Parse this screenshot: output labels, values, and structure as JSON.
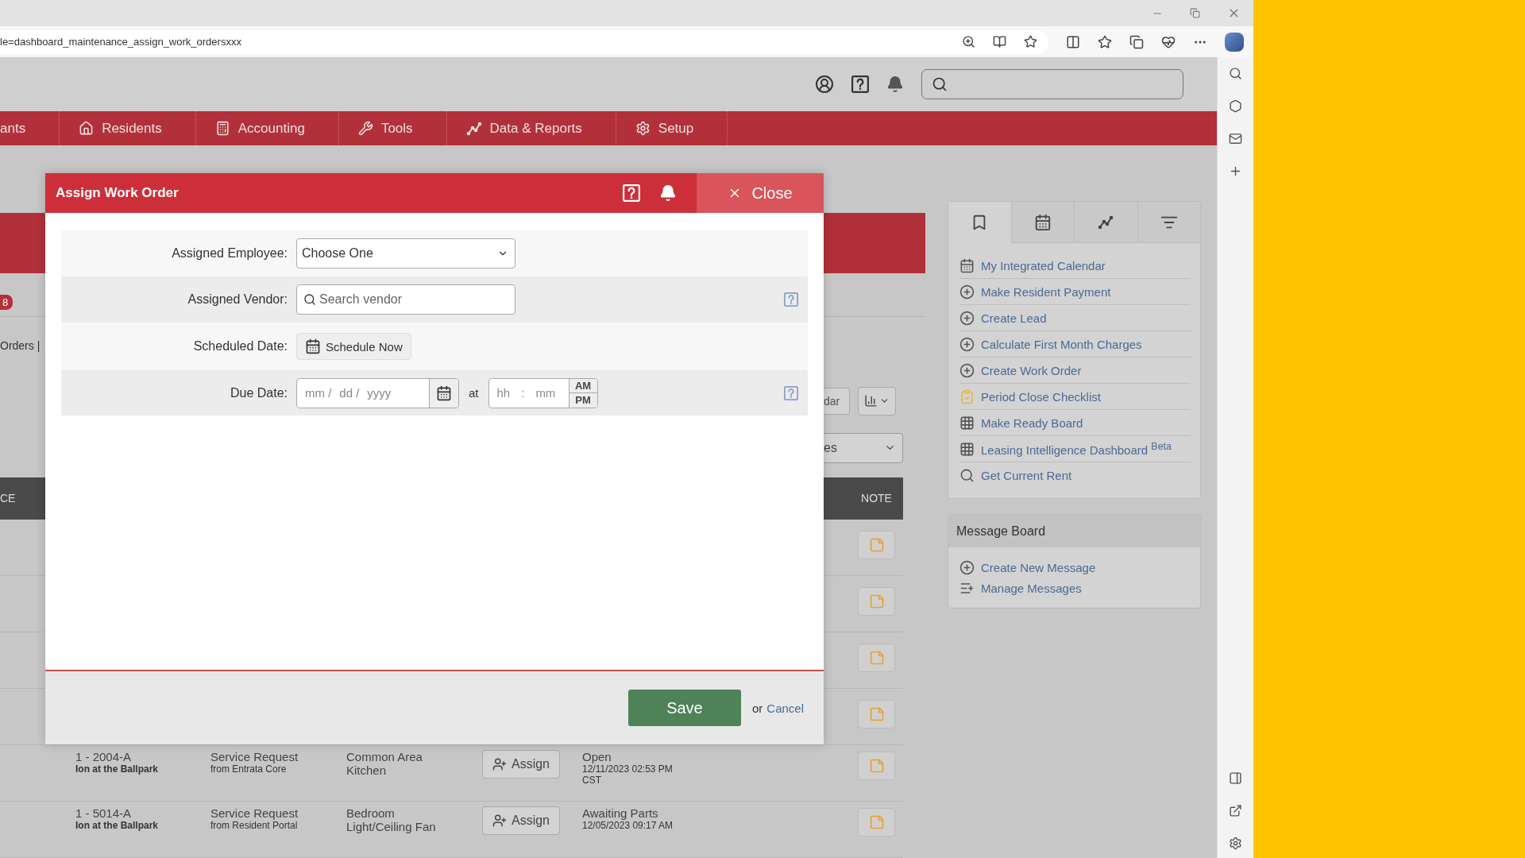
{
  "browser": {
    "url": "le=dashboard_maintenance_assign_work_ordersxxx"
  },
  "nav": [
    {
      "label": "ants",
      "kind": "plain"
    },
    {
      "label": "Residents",
      "kind": "home"
    },
    {
      "label": "Accounting",
      "kind": "calculator"
    },
    {
      "label": "Tools",
      "kind": "tools"
    },
    {
      "label": "Data & Reports",
      "kind": "data"
    },
    {
      "label": "Setup",
      "kind": "gear"
    }
  ],
  "background": {
    "tab_badge": "8",
    "breadcrumb": "Orders |",
    "calendar_button": "dar",
    "filter_select": "es"
  },
  "table": {
    "columns": [
      "CE",
      "NOTE"
    ],
    "rows": [
      {
        "kind": "covered"
      },
      {
        "kind": "covered"
      },
      {
        "kind": "covered"
      },
      {
        "kind": "covered"
      },
      {
        "kind": "full",
        "unit": "1 - 2004-A",
        "property": "Ion at the Ballpark",
        "type": "Service Request",
        "source": "from Entrata Core",
        "location": "Common Area Kitchen",
        "action": "Assign",
        "status": "Open",
        "date": "12/11/2023 02:53 PM",
        "zone": "CST"
      },
      {
        "kind": "full",
        "unit": "1 - 5014-A",
        "property": "Ion at the Ballpark",
        "type": "Service Request",
        "source": "from Resident Portal",
        "location": "Bedroom Light/Ceiling Fan",
        "action": "Assign",
        "status": "Awaiting Parts",
        "date": "12/05/2023 09:17 AM"
      }
    ]
  },
  "modal": {
    "title": "Assign Work Order",
    "close": "Close",
    "fields": [
      {
        "kind": "select",
        "label": "Assigned Employee:",
        "value": "Choose One",
        "help": false
      },
      {
        "kind": "search",
        "label": "Assigned Vendor:",
        "placeholder": "Search vendor",
        "help": true
      },
      {
        "kind": "schedule",
        "label": "Scheduled Date:",
        "button": "Schedule Now",
        "help": false
      },
      {
        "kind": "due",
        "label": "Due Date:",
        "date_parts": [
          "mm /",
          "dd /",
          "yyyy"
        ],
        "at": "at",
        "time_parts": [
          "hh",
          ":",
          "mm"
        ],
        "meridiem": [
          "AM",
          "PM"
        ],
        "help": true
      }
    ],
    "save": "Save",
    "or": "or",
    "cancel": "Cancel"
  },
  "sidebar": {
    "tabs": [
      {
        "kind": "bookmark",
        "selected": true
      },
      {
        "kind": "calendar",
        "selected": false
      },
      {
        "kind": "chart",
        "selected": false
      },
      {
        "kind": "filter",
        "selected": false
      }
    ],
    "links": [
      {
        "kind": "calendar",
        "label": "My Integrated Calendar"
      },
      {
        "kind": "plus",
        "label": "Make Resident Payment"
      },
      {
        "kind": "plus",
        "label": "Create Lead"
      },
      {
        "kind": "plus",
        "label": "Calculate First Month Charges"
      },
      {
        "kind": "plus",
        "label": "Create Work Order"
      },
      {
        "kind": "clipboard",
        "label": "Period Close Checklist"
      },
      {
        "kind": "grid",
        "label": "Make Ready Board"
      },
      {
        "kind": "grid",
        "label": "Leasing Intelligence Dashboard $^{Beta}$"
      },
      {
        "kind": "search",
        "label": "Get Current Rent"
      }
    ]
  },
  "message_board": {
    "title": "Message Board",
    "links": [
      {
        "kind": "plus",
        "label": "Create New Message"
      },
      {
        "kind": "list",
        "label": "Manage Messages"
      }
    ]
  }
}
